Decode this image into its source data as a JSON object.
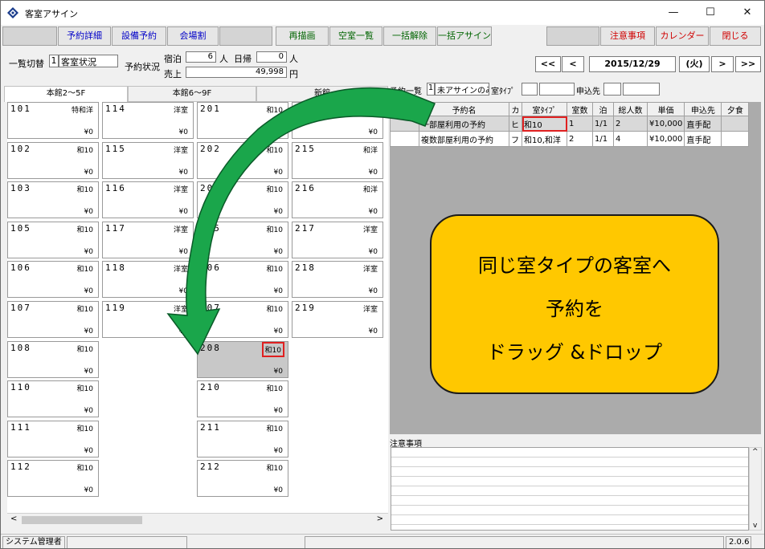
{
  "window": {
    "title": "客室アサイン",
    "minimize": "—",
    "maximize": "☐",
    "close": "✕"
  },
  "toolbar": {
    "reservation_detail": "予約詳細",
    "equipment": "設備予約",
    "venue_split": "会場割",
    "redraw": "再描画",
    "vacancy_list": "空室一覧",
    "bulk_release": "一括解除",
    "bulk_assign": "一括アサイン",
    "notice": "注意事項",
    "calendar": "カレンダー",
    "close": "閉じる"
  },
  "header": {
    "list_switch_label": "一覧切替",
    "list_switch_num": "1",
    "list_switch_value": "客室状況",
    "res_status_label": "予約状況",
    "stay_label": "宿泊",
    "stay_value": "6",
    "person_unit": "人",
    "day_trip_label": "日帰",
    "day_trip_value": "0",
    "person_unit2": "人",
    "sales_label": "売上",
    "sales_value": "49,998",
    "yen_unit": "円"
  },
  "date_nav": {
    "first": "<<",
    "prev": "<",
    "date": "2015/12/29",
    "weekday": "(火)",
    "next": ">",
    "last": ">>"
  },
  "tabs": [
    "本館2～5F",
    "本館6～9F",
    "新館"
  ],
  "rooms": [
    {
      "num": "101",
      "type": "特和洋",
      "price": "¥0"
    },
    {
      "num": "102",
      "type": "和10",
      "price": "¥0"
    },
    {
      "num": "103",
      "type": "和10",
      "price": "¥0"
    },
    {
      "num": "105",
      "type": "和10",
      "price": "¥0"
    },
    {
      "num": "106",
      "type": "和10",
      "price": "¥0"
    },
    {
      "num": "107",
      "type": "和10",
      "price": "¥0"
    },
    {
      "num": "108",
      "type": "和10",
      "price": "¥0"
    },
    {
      "num": "110",
      "type": "和10",
      "price": "¥0"
    },
    {
      "num": "111",
      "type": "和10",
      "price": "¥0"
    },
    {
      "num": "112",
      "type": "和10",
      "price": "¥0"
    },
    {
      "num": "114",
      "type": "洋室",
      "price": "¥0"
    },
    {
      "num": "115",
      "type": "洋室",
      "price": "¥0"
    },
    {
      "num": "116",
      "type": "洋室",
      "price": "¥0"
    },
    {
      "num": "117",
      "type": "洋室",
      "price": "¥0"
    },
    {
      "num": "118",
      "type": "洋室",
      "price": "¥0"
    },
    {
      "num": "119",
      "type": "洋室",
      "price": "¥0"
    },
    {
      "num": "201",
      "type": "和10",
      "price": "¥0"
    },
    {
      "num": "202",
      "type": "和10",
      "price": "¥0"
    },
    {
      "num": "203",
      "type": "和10",
      "price": "¥0"
    },
    {
      "num": "205",
      "type": "和10",
      "price": "¥0"
    },
    {
      "num": "206",
      "type": "和10",
      "price": "¥0"
    },
    {
      "num": "207",
      "type": "和10",
      "price": "¥0"
    },
    {
      "num": "208",
      "type": "和10",
      "price": "¥0"
    },
    {
      "num": "210",
      "type": "和10",
      "price": "¥0"
    },
    {
      "num": "211",
      "type": "和10",
      "price": "¥0"
    },
    {
      "num": "212",
      "type": "和10",
      "price": "¥0"
    },
    {
      "num": "215",
      "type": "和洋",
      "price": "¥0"
    },
    {
      "num": "216",
      "type": "和洋",
      "price": "¥0"
    },
    {
      "num": "217",
      "type": "洋室",
      "price": "¥0"
    },
    {
      "num": "218",
      "type": "洋室",
      "price": "¥0"
    },
    {
      "num": "219",
      "type": "洋室",
      "price": "¥0"
    },
    {
      "num": "",
      "type": "和10",
      "price": "¥0"
    }
  ],
  "res_filter": {
    "list_label": "予約一覧",
    "list_num": "1",
    "list_value": "未アサインのみ",
    "room_type_label": "室ﾀｲﾌﾟ",
    "agent_label": "申込先"
  },
  "res_columns": [
    "予約名",
    "カ",
    "室ﾀｲﾌﾟ",
    "室数",
    "泊",
    "総人数",
    "単価",
    "申込先",
    "夕食"
  ],
  "res_rows": [
    {
      "name": "一部屋利用の予約",
      "ka": "ヒ",
      "room_type": "和10",
      "rooms": "1",
      "nights": "1/1",
      "people": "2",
      "price": "¥10,000",
      "agent": "直手配",
      "dinner": ""
    },
    {
      "name": "複数部屋利用の予約",
      "ka": "フ",
      "room_type": "和10,和洋",
      "rooms": "2",
      "nights": "1/1",
      "people": "4",
      "price": "¥10,000",
      "agent": "直手配",
      "dinner": ""
    }
  ],
  "callout": {
    "line1": "同じ室タイプの客室へ",
    "line2": "予約を",
    "line3": "ドラッグ &ドロップ"
  },
  "notes": {
    "label": "注意事項"
  },
  "status": {
    "user": "システム管理者",
    "version": "2.0.6"
  },
  "scroll": {
    "left": "<",
    "right": ">",
    "up": "^",
    "down": "v"
  },
  "colors": {
    "accent_blue": "#0000c8",
    "accent_green": "#006400",
    "accent_red": "#d00000",
    "callout_fill": "#ffc800",
    "arrow_fill": "#1aa64b",
    "highlight": "#e02020"
  }
}
